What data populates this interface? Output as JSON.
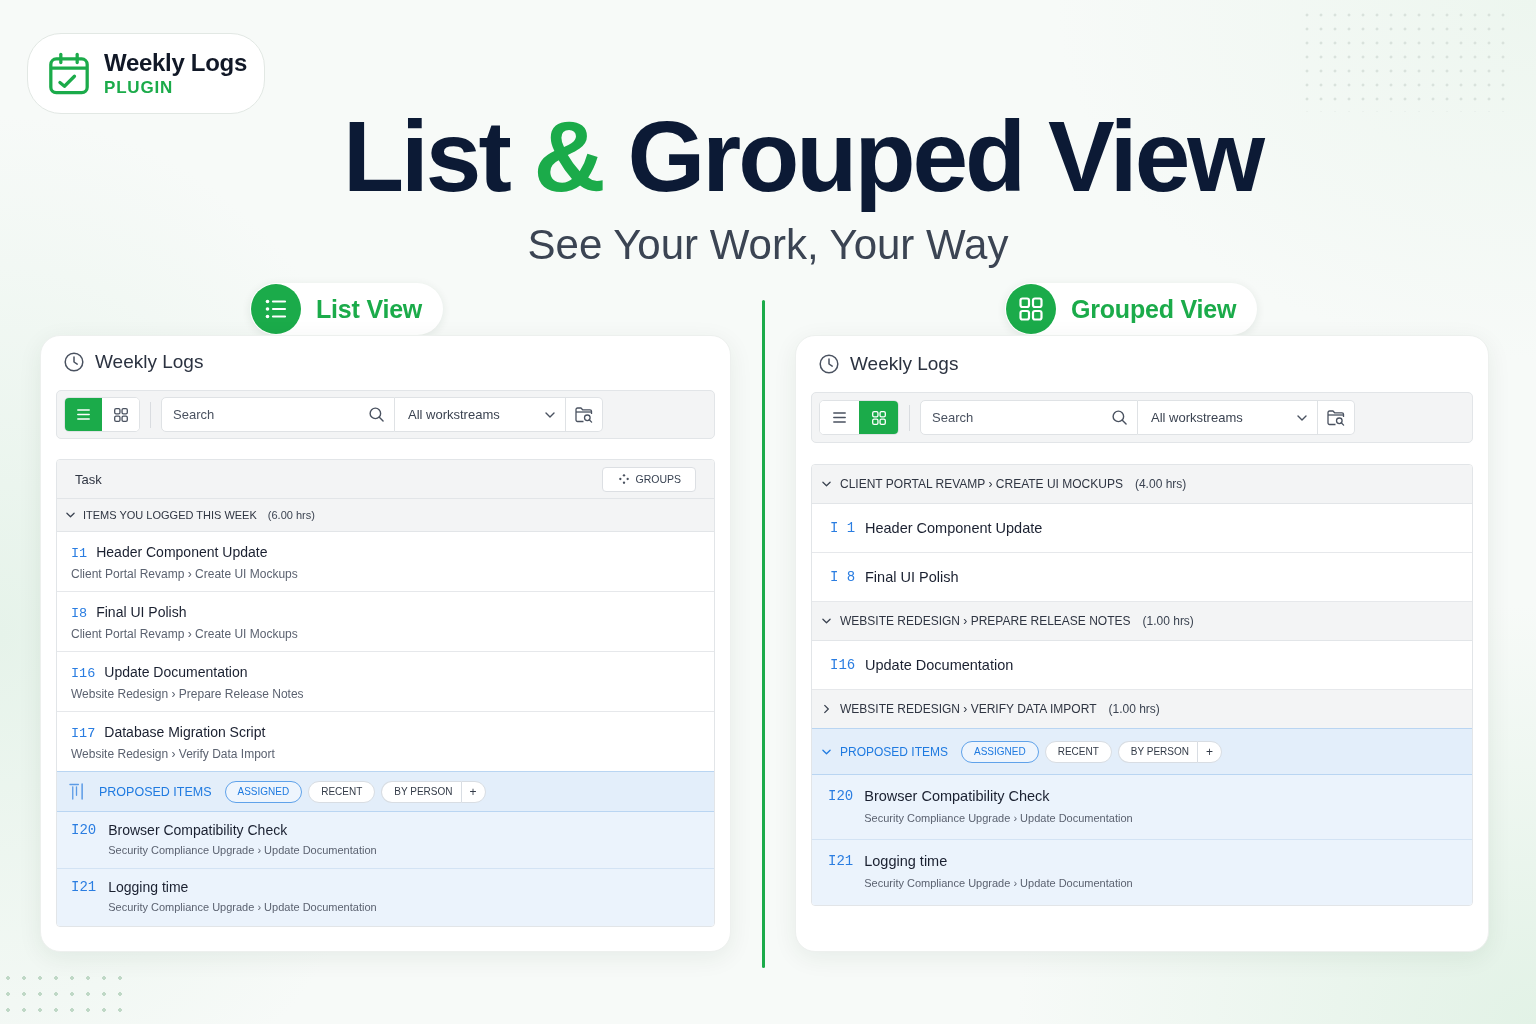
{
  "logo": {
    "title": "Weekly Logs",
    "subtitle": "PLUGIN"
  },
  "headline": [
    {
      "text": "List",
      "accent": false
    },
    {
      "text": "&",
      "accent": true
    },
    {
      "text": "Grouped View",
      "accent": false
    }
  ],
  "tagline": "See Your Work, Your Way",
  "panels": [
    {
      "kind": "list",
      "label": "List View",
      "title": "Weekly Logs",
      "view_toggle": [
        {
          "kind": "list",
          "selected": true
        },
        {
          "kind": "grid",
          "selected": false
        }
      ],
      "search": {
        "placeholder": "Search"
      },
      "workstream": {
        "value": "All workstreams"
      },
      "table_header": {
        "column": "Task",
        "button": "GROUPS"
      },
      "groups": [
        {
          "title": "ITEMS YOU LOGGED THIS WEEK",
          "hours": "(6.00 hrs)",
          "expanded": true,
          "items": [
            {
              "id": "I1",
              "title": "Header Component Update",
              "path": "Client Portal Revamp › Create UI Mockups"
            },
            {
              "id": "I8",
              "title": "Final UI Polish",
              "path": "Client Portal Revamp › Create UI Mockups"
            },
            {
              "id": "I16",
              "title": "Update Documentation",
              "path": "Website Redesign › Prepare Release Notes"
            },
            {
              "id": "I17",
              "title": "Database Migration Script",
              "path": "Website Redesign › Verify Data Import"
            }
          ]
        }
      ],
      "proposed": {
        "title": "PROPOSED ITEMS",
        "filters": [
          {
            "label": "ASSIGNED",
            "selected": true
          },
          {
            "label": "RECENT",
            "selected": false
          },
          {
            "label": "BY PERSON",
            "selected": false
          }
        ],
        "add_button": "+",
        "items": [
          {
            "id": "I20",
            "title": "Browser Compatibility Check",
            "path": "Security Compliance Upgrade › Update Documentation"
          },
          {
            "id": "I21",
            "title": "Logging time",
            "path": "Security Compliance Upgrade › Update Documentation"
          }
        ]
      }
    },
    {
      "kind": "grouped",
      "label": "Grouped View",
      "title": "Weekly Logs",
      "view_toggle": [
        {
          "kind": "list",
          "selected": false
        },
        {
          "kind": "grid",
          "selected": true
        }
      ],
      "search": {
        "placeholder": "Search"
      },
      "workstream": {
        "value": "All workstreams"
      },
      "groups": [
        {
          "title": "CLIENT PORTAL REVAMP › CREATE UI MOCKUPS",
          "hours": "(4.00 hrs)",
          "expanded": true,
          "items": [
            {
              "id": "I 1",
              "title": "Header Component Update"
            },
            {
              "id": "I 8",
              "title": "Final UI Polish"
            }
          ]
        },
        {
          "title": "WEBSITE REDESIGN › PREPARE RELEASE NOTES",
          "hours": "(1.00 hrs)",
          "expanded": true,
          "items": [
            {
              "id": "I16",
              "title": "Update Documentation"
            }
          ]
        },
        {
          "title": "WEBSITE REDESIGN › VERIFY DATA IMPORT",
          "hours": "(1.00 hrs)",
          "expanded": false
        }
      ],
      "proposed": {
        "title": "PROPOSED ITEMS",
        "expanded": true,
        "filters": [
          {
            "label": "ASSIGNED",
            "selected": true
          },
          {
            "label": "RECENT",
            "selected": false
          },
          {
            "label": "BY PERSON",
            "selected": false
          }
        ],
        "add_button": "+",
        "items": [
          {
            "id": "I20",
            "title": "Browser Compatibility Check",
            "path": "Security Compliance Upgrade › Update Documentation"
          },
          {
            "id": "I21",
            "title": "Logging time",
            "path": "Security Compliance Upgrade › Update Documentation"
          }
        ]
      }
    }
  ]
}
